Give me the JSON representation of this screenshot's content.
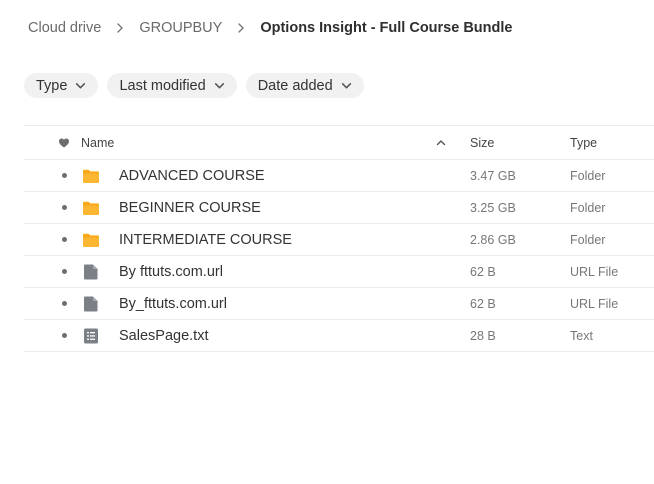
{
  "breadcrumb": {
    "items": [
      "Cloud drive",
      "GROUPBUY"
    ],
    "current": "Options Insight - Full Course Bundle"
  },
  "filters": [
    "Type",
    "Last modified",
    "Date added"
  ],
  "table": {
    "headers": {
      "name": "Name",
      "size": "Size",
      "type": "Type"
    },
    "rows": [
      {
        "name": "ADVANCED COURSE",
        "size": "3.47 GB",
        "type": "Folder",
        "icon": "folder-icon"
      },
      {
        "name": "BEGINNER COURSE",
        "size": "3.25 GB",
        "type": "Folder",
        "icon": "folder-icon"
      },
      {
        "name": "INTERMEDIATE COURSE",
        "size": "2.86 GB",
        "type": "Folder",
        "icon": "folder-icon"
      },
      {
        "name": "By fttuts.com.url",
        "size": "62 B",
        "type": "URL File",
        "icon": "file-icon"
      },
      {
        "name": "By_fttuts.com.url",
        "size": "62 B",
        "type": "URL File",
        "icon": "file-icon"
      },
      {
        "name": "SalesPage.txt",
        "size": "28 B",
        "type": "Text",
        "icon": "text-file-icon"
      }
    ]
  },
  "colors": {
    "folder": "#f9a91b",
    "file": "#7b7f86"
  }
}
